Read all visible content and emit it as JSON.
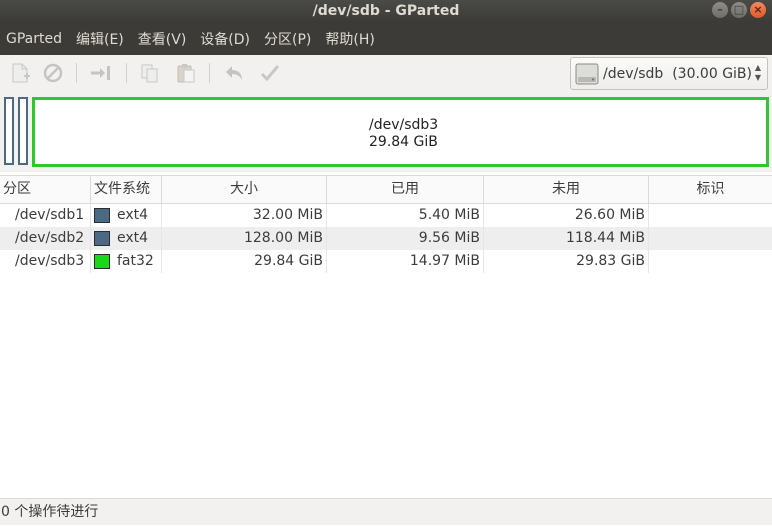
{
  "window": {
    "title": "/dev/sdb - GParted"
  },
  "menu": {
    "items": [
      "GParted",
      "编辑(E)",
      "查看(V)",
      "设备(D)",
      "分区(P)",
      "帮助(H)"
    ]
  },
  "toolbar": {
    "icons": [
      "new-partition-icon",
      "delete-icon",
      "resize-move-icon",
      "copy-icon",
      "paste-icon",
      "undo-icon",
      "apply-icon"
    ],
    "device": "/dev/sdb",
    "device_size": "(30.00 GiB)"
  },
  "visual": {
    "selected_name": "/dev/sdb3",
    "selected_size": "29.84 GiB",
    "accent_color": "#2ec72e"
  },
  "table": {
    "headers": [
      "分区",
      "文件系统",
      "大小",
      "已用",
      "未用",
      "标识"
    ],
    "rows": [
      {
        "partition": "/dev/sdb1",
        "fs": "ext4",
        "fs_color": "#4b6983",
        "size": "32.00 MiB",
        "used": "5.40 MiB",
        "unused": "26.60 MiB",
        "flags": ""
      },
      {
        "partition": "/dev/sdb2",
        "fs": "ext4",
        "fs_color": "#4b6983",
        "size": "128.00 MiB",
        "used": "9.56 MiB",
        "unused": "118.44 MiB",
        "flags": ""
      },
      {
        "partition": "/dev/sdb3",
        "fs": "fat32",
        "fs_color": "#18d918",
        "size": "29.84 GiB",
        "used": "14.97 MiB",
        "unused": "29.83 GiB",
        "flags": ""
      }
    ]
  },
  "status": {
    "text": "0 个操作待进行"
  }
}
